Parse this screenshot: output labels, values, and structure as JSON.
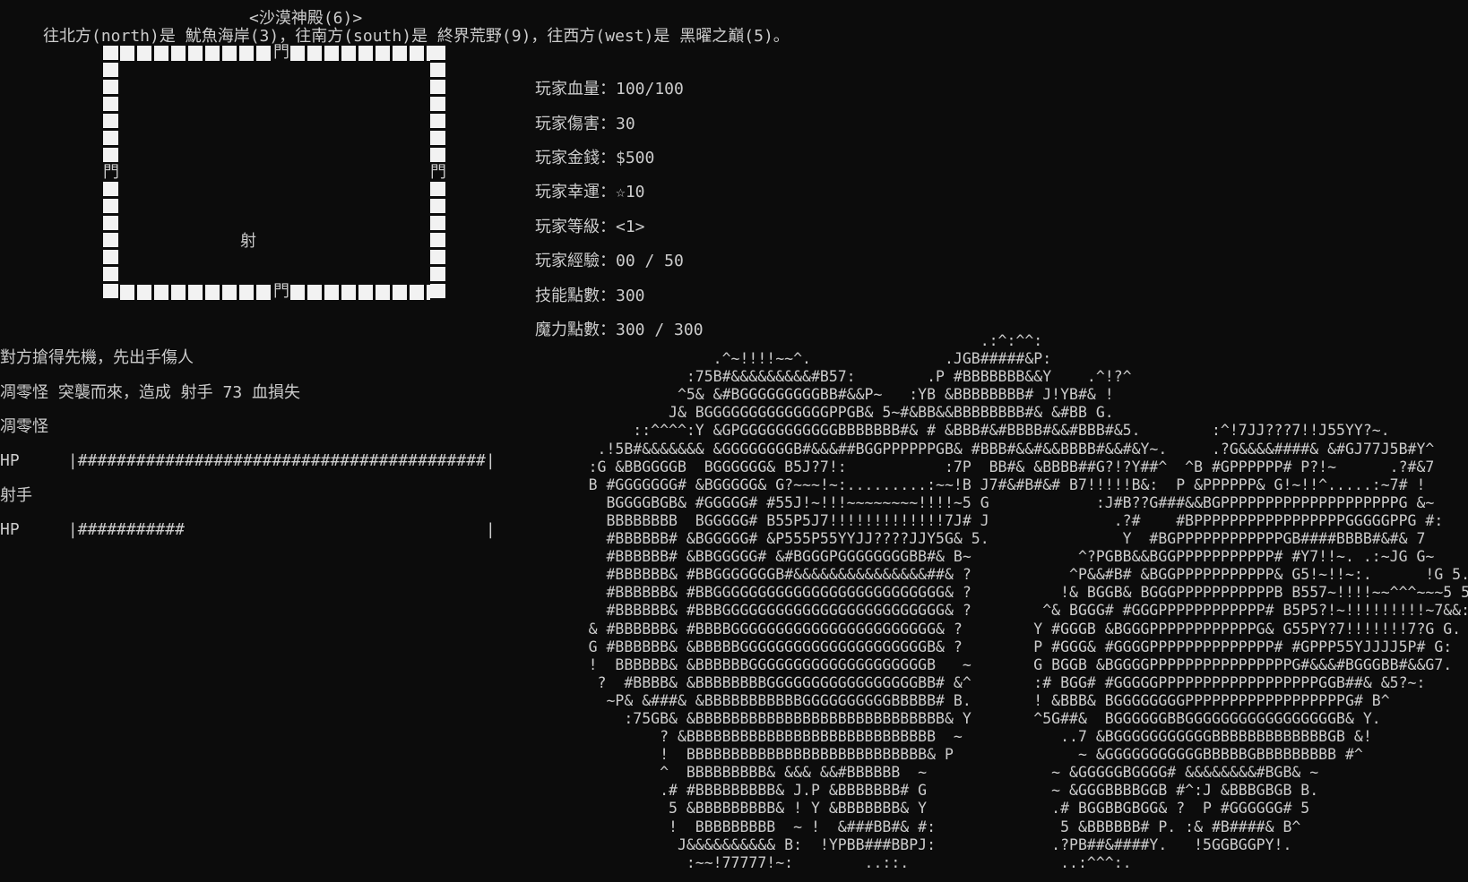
{
  "room_title": "<沙漠神殿(6)>",
  "exits_text": "往北方(north)是 魷魚海岸(3)，往南方(south)是 終界荒野(9)，往西方(west)是 黑曜之巔(5)。",
  "map": {
    "door_glyph": "門",
    "player_glyph": "射"
  },
  "stats": [
    {
      "label": "玩家血量",
      "value": "100/100"
    },
    {
      "label": "玩家傷害",
      "value": "30"
    },
    {
      "label": "玩家金錢",
      "value": "$500"
    },
    {
      "label": "玩家幸運",
      "value": "☆10"
    },
    {
      "label": "玩家等級",
      "value": "<1>"
    },
    {
      "label": "玩家經驗",
      "value": "00 / 50"
    },
    {
      "label": "技能點數",
      "value": "300"
    },
    {
      "label": "魔力點數",
      "value": "300 / 300"
    }
  ],
  "battle_log": {
    "line1": "對方搶得先機，先出手傷人",
    "line2": "凋零怪 突襲而來，造成 射手 73 血損失",
    "enemy_name": "凋零怪",
    "enemy_hp_label": "HP",
    "enemy_hp_bar": "|##########################################|",
    "player_name": "射手",
    "player_hp_label": "HP",
    "player_hp_bar": "|###########                               |",
    "player_hp_fraction": 0.27
  },
  "ascii_art": "                                                  .:^:^^:\n                    .^~!!!!~~^.               .JGB#####&P:\n                 :75B#&&&&&&&&&#B57:        .P #BBBBBBB&&Y    .^!?^\n                ^5& &#BGGGGGGGGGBB#&&P~   :YB &BBBBBBBB# J!YB#& !\n               J& BGGGGGGGGGGGGGGPPGB& 5~#&BB&&BBBBBBBB#& &#BB G.\n           ::^^^^:Y &GPGGGGGGGGGGGBBBBBBB#& # &BBB#&#BBBB#&&#BBB#&5.        :^!7JJ???7!!J55YY?~.\n       .!5B#&&&&&&& &GGGGGGGGB#&&&##BGGPPPPPPGB& #BBB#&&#&&BBBB#&&#&Y~.     .?G&&&&####& &#GJ77J5B#Y^\n      :G &BBGGGGB  BGGGGGG& B5J?7!:           :7P  BB#& &BBBB##G?!?Y##^  ^B #GPPPPPP# P?!~      .?#&7\n      B #GGGGGGG# &BGGGGG& G?~~~!~:.........:~~!B J7#&#B#&# B7!!!!!B&:  P &PPPPPP& G!~!!^.....:~7# !\n        BGGGGBGB& #GGGGG# #55J!~!!!~~~~~~~~!!!!~5 G            :J#B??G###&&BGPPPPPPPPPPPPPPPPPPPPG &~\n        BBBBBBBB  BGGGGG# B55P5J7!!!!!!!!!!!!!7J# J              .?#    #BPPPPPPPPPPPPPPPPPGGGGGPPG #:\n        #BBBBBB# &BGGGGG# &P555P55YYJJ????JJY5G& 5.               Y  #BGPPPPPPPPPPPPGB####BBBB#&#& 7\n        #BBBBBB# &BBGGGGG# &#BGGGPGGGGGGGGBB#& B~            ^?PGBB&&BGGPPPPPPPPPPP# #Y7!!~. .:~JG G~\n        #BBBBBB& #BBGGGGGGGB#&&&&&&&&&&&&&&&##& ?           ^P&&#B# &BGGPPPPPPPPPPP& G5!~!!~:.      !G 5.\n        #BBBBBB& #BBGGGGGGGGGGGGGGGGGGGGGGGGGG& ?          !& BGGB& BGGGPPPPPPPPPPPB B557~!!!!~~^^^~~~5 5\n        #BBBBBB& #BBBGGGGGGGGGGGGGGGGGGGGGGGGG& ?        ^& BGGG# #GGGPPPPPPPPPPPP# B5P5?!~!!!!!!!!!~7&&:\n      & #BBBBBB& #BBBBGGGGGGGGGGGGGGGGGGGGGGG& ?        Y #GGGB &BGGGPPPPPPPPPPPPG& G55PY?7!!!!!!!7?G G.\n      G #BBBBBB& &BBBBBGGGGGGGGGGGGGGGGGGGGGB& ?        P #GGG& #GGGGPPPPPPPPPPPPPP# #GPPP55YJJJJ5P# G:\n      !  BBBBBB& &BBBBBBGGGGGGGGGGGGGGGGGGGGB   ~       G BGGB &BGGGGPPPPPPPPPPPPPPPPG#&&&#BGGGBB#&&G7.\n       ?  #BBBB& &BBBBBBBBGGGGGGGGGGGGGGGGGBB# &^       :# BGG# #GGGGGPPPPPPPPPPPPPPPPPPGGB##& &5?~:\n        ~P& &###& &BBBBBBBBBBBGGGGGGGGGGBBBBB# B.       ! &BBB& BGGGGGGGGPPPPPPPPPPPPPPPPPPG# B^\n          :75GB& &BBBBBBBBBBBBBBBBBBBBBBBBBBBB& Y       ^5G##&  BGGGGGGBBGGGGGGGGGGGGGGGGGB& Y.\n              ? &BBBBBBBBBBBBBBBBBBBBBBBBBBBB  ~           ..7 &BGGGGGGGGGGGBBBBBBBBBBBBBGB &!\n              !  BBBBBBBBBBBBBBBBBBBBBBBBBBB& P              ~ &GGGGGGGGGGGBBBBBGBBBBBBBBB #^\n              ^  BBBBBBBBB& &&& &&#BBBBBB  ~              ~ &GGGGGBGGGG# &&&&&&&&#BGB& ~\n              .# #BBBBBBBBB& J.P &BBBBBBB# G              ~ &GGGBBBBGGB #^:J &BBBGBGB B.\n               5 &BBBBBBBBB& ! Y &BBBBBBB& Y              .# BGGBBGBGG& ?  P #GGGGGG# 5\n               !  BBBBBBBBB  ~ !  &###BB#& #:              5 &BBBBBB# P. :& #B####& B^\n                J&&&&&&&&&& B:  !YPBB###BBPJ:             .?PB##&####Y.   !5GGBGGPY!.\n                 :~~!77777!~:        ..::.                 ..:^^^:."
}
